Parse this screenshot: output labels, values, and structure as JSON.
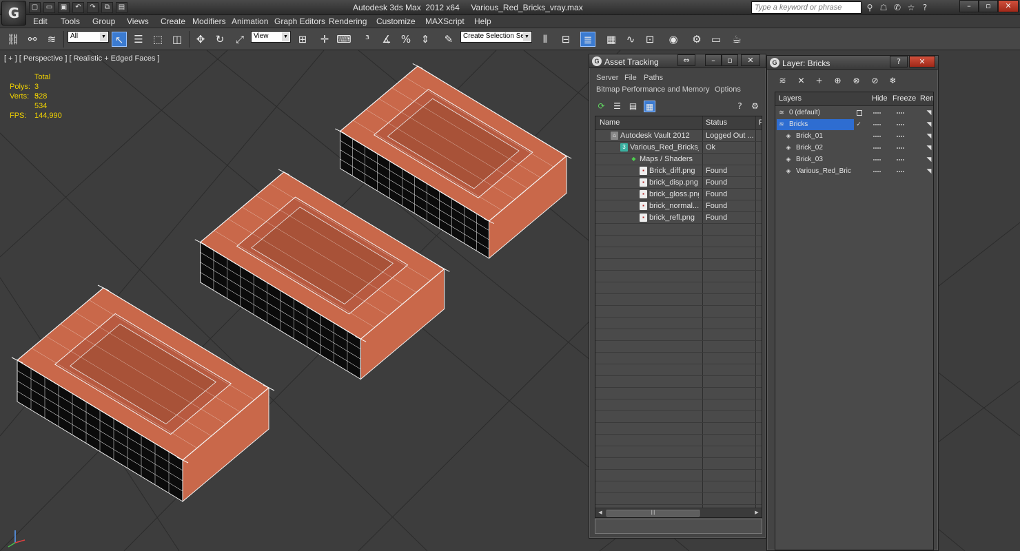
{
  "app": {
    "title": "Autodesk 3ds Max  2012 x64     Various_Red_Bricks_vray.max",
    "logo": "G",
    "search_placeholder": "Type a keyword or phrase"
  },
  "menu": [
    "Edit",
    "Tools",
    "Group",
    "Views",
    "Create",
    "Modifiers",
    "Animation",
    "Graph Editors",
    "Rendering",
    "Customize",
    "MAXScript",
    "Help"
  ],
  "toolbar": {
    "selection_filter": "All",
    "ref_coord": "View",
    "named_selection": "Create Selection Se"
  },
  "viewport": {
    "label": "[ + ] [ Perspective ] [ Realistic + Edged Faces ]",
    "stats": {
      "total_label": "Total",
      "polys_label": "Polys:",
      "polys_value": "3 528",
      "verts_label": "Verts:",
      "verts_value": "3 534",
      "fps_label": "FPS:",
      "fps_value": "144,990"
    },
    "brick_color": "#c9684a"
  },
  "asset_tracking": {
    "title": "Asset Tracking",
    "menu1": [
      "Server",
      "File",
      "Paths"
    ],
    "menu2": [
      "Bitmap Performance and Memory",
      "Options"
    ],
    "col_name": "Name",
    "col_status": "Status",
    "col_extra": "P",
    "rows": [
      {
        "name": "Autodesk Vault 2012",
        "status": "Logged Out ...",
        "icon": "vault-icon"
      },
      {
        "name": "Various_Red_Bricks_...",
        "status": "Ok",
        "icon": "max-file-icon"
      },
      {
        "name": "Maps / Shaders",
        "status": "",
        "icon": "maps-icon"
      },
      {
        "name": "Brick_diff.png",
        "status": "Found",
        "icon": "bitmap-icon"
      },
      {
        "name": "brick_disp.png",
        "status": "Found",
        "icon": "bitmap-icon"
      },
      {
        "name": "brick_gloss.png",
        "status": "Found",
        "icon": "bitmap-icon"
      },
      {
        "name": "brick_normal....",
        "status": "Found",
        "icon": "bitmap-icon"
      },
      {
        "name": "brick_refl.png",
        "status": "Found",
        "icon": "bitmap-icon"
      }
    ]
  },
  "layers": {
    "title": "Layer: Bricks",
    "col_layers": "Layers",
    "col_hide": "Hide",
    "col_freeze": "Freeze",
    "col_render": "Ren",
    "rows": [
      {
        "name": "0 (default)",
        "level": 0
      },
      {
        "name": "Bricks",
        "level": 0,
        "selected": true
      },
      {
        "name": "Brick_01",
        "level": 1
      },
      {
        "name": "Brick_02",
        "level": 1
      },
      {
        "name": "Brick_03",
        "level": 1
      },
      {
        "name": "Various_Red_Bric",
        "level": 1
      }
    ],
    "selection_color": "#2e6dd1"
  }
}
